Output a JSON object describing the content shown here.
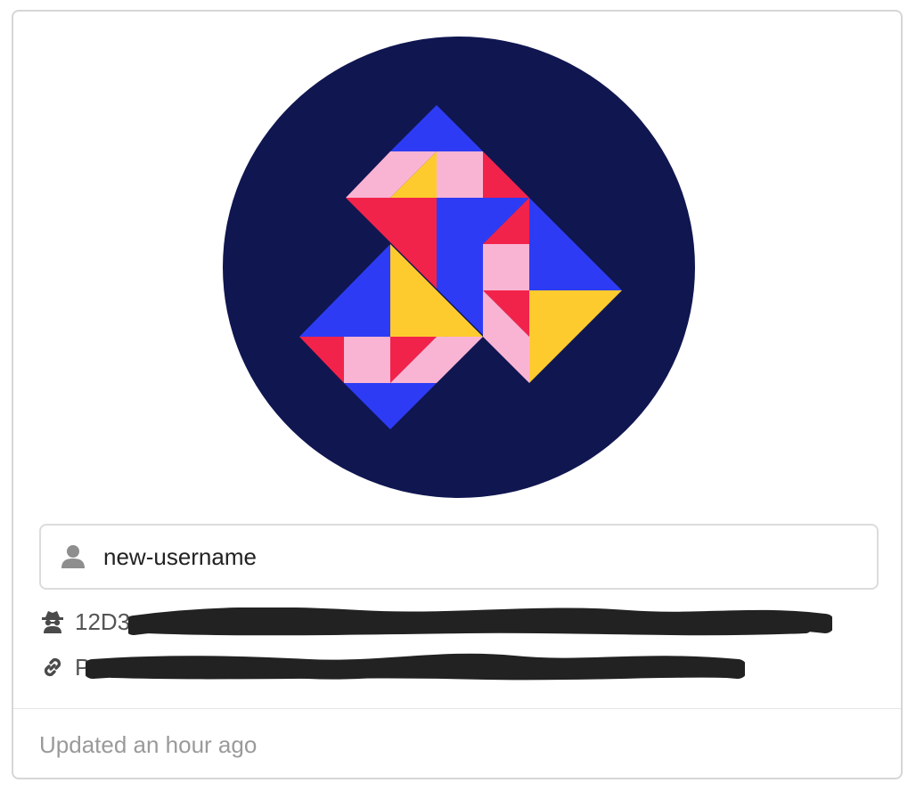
{
  "card": {
    "avatar": {
      "icon": "geometric-logo-icon",
      "background_color": "#101650",
      "palette": [
        "#2d3cf4",
        "#f9b4d4",
        "#fecb2f",
        "#f2234b"
      ]
    },
    "username_field": {
      "icon": "user-icon",
      "value": "new-username"
    },
    "peer_id": {
      "icon": "incognito-icon",
      "visible_text": "12D3"
    },
    "address": {
      "icon": "link-icon",
      "visible_text": "P"
    },
    "footer": {
      "updated_text": "Updated an hour ago"
    }
  }
}
